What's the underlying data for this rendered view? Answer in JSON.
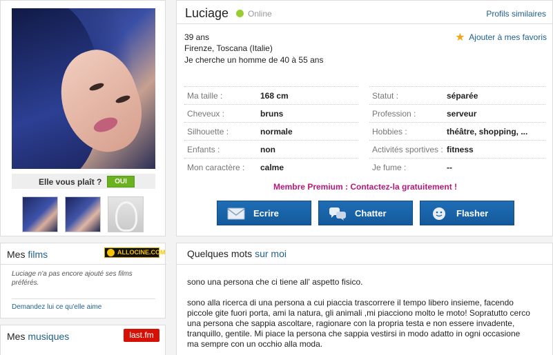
{
  "photo_panel": {
    "like_question": "Elle vous plaît ?",
    "yes_label": "OUI"
  },
  "profile": {
    "username": "Luciage",
    "status": "Online",
    "similar_link": "Profils similaires",
    "favorites_link": "Ajouter à mes favoris",
    "age": "39 ans",
    "location": "Firenze, Toscana (Italie)",
    "looking_for": "Je cherche un homme de 40 à 55 ans",
    "left_attributes": [
      {
        "label": "Ma taille :",
        "value": "168 cm"
      },
      {
        "label": "Cheveux :",
        "value": "bruns"
      },
      {
        "label": "Silhouette :",
        "value": "normale"
      },
      {
        "label": "Enfants :",
        "value": "non"
      },
      {
        "label": "Mon caractère :",
        "value": "calme"
      }
    ],
    "right_attributes": [
      {
        "label": "Statut :",
        "value": "séparée"
      },
      {
        "label": "Profession :",
        "value": "serveur"
      },
      {
        "label": "Hobbies :",
        "value": "théâtre, shopping, ..."
      },
      {
        "label": "Activités sportives :",
        "value": "fitness"
      },
      {
        "label": "Je fume :",
        "value": "--"
      }
    ],
    "premium_text": "Membre Premium : Contactez-la gratuitement !",
    "actions": [
      {
        "label": "Ecrire",
        "icon": "envelope-icon"
      },
      {
        "label": "Chatter",
        "icon": "chat-bubbles-icon"
      },
      {
        "label": "Flasher",
        "icon": "smiley-icon"
      }
    ]
  },
  "films": {
    "title_prefix": "Mes ",
    "title_accent": "films",
    "logo_text": "ALLOCINE.COM",
    "empty_text": "Luciage n'a pas encore ajouté ses films préférés.",
    "ask_link": "Demandez lui ce qu'elle aime"
  },
  "music": {
    "title_prefix": "Mes ",
    "title_accent": "musiques",
    "logo_text": "last.fm"
  },
  "about": {
    "title_prefix": "Quelques mots ",
    "title_accent": "sur moi",
    "paragraph1": "sono una persona che ci tiene all' aspetto fisico.",
    "paragraph2": "sono alla ricerca di una persona a cui piaccia trascorrere il tempo libero insieme, facendo piccole gite fuori porta, ami la natura, gli animali ,mi piacciono molto le moto! Sopratutto cerco una persona che sappia ascoltare, ragionare con la propria testa e non essere invadente, tranquillo, gentile. Mi piace la persona che sappia vestirsi in modo adatto in ogni occasione ma sempre con un occhio alla moda."
  },
  "colors": {
    "link_blue": "#1f5f8b",
    "button_blue": "#1a65ab",
    "premium_magenta": "#b5187a",
    "online_green": "#9acd32",
    "yes_green": "#6ab31e"
  }
}
